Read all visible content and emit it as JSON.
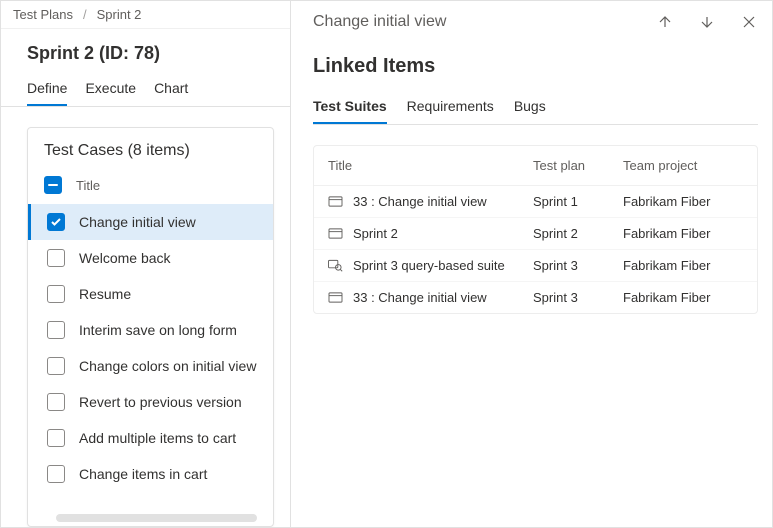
{
  "breadcrumb": {
    "root": "Test Plans",
    "current": "Sprint 2"
  },
  "page": {
    "title": "Sprint 2 (ID: 78)"
  },
  "tabs": {
    "define": "Define",
    "execute": "Execute",
    "chart": "Chart"
  },
  "testcases": {
    "header": "Test Cases (8 items)",
    "title_col": "Title",
    "items": [
      {
        "label": "Change initial view",
        "selected": true
      },
      {
        "label": "Welcome back",
        "selected": false
      },
      {
        "label": "Resume",
        "selected": false
      },
      {
        "label": "Interim save on long form",
        "selected": false
      },
      {
        "label": "Change colors on initial view",
        "selected": false
      },
      {
        "label": "Revert to previous version",
        "selected": false
      },
      {
        "label": "Add multiple items to cart",
        "selected": false
      },
      {
        "label": "Change items in cart",
        "selected": false
      }
    ]
  },
  "sidepanel": {
    "title": "Change initial view",
    "section_header": "Linked Items",
    "tabs": {
      "suites": "Test Suites",
      "reqs": "Requirements",
      "bugs": "Bugs"
    },
    "columns": {
      "title": "Title",
      "plan": "Test plan",
      "project": "Team project"
    },
    "rows": [
      {
        "icon": "static",
        "title": "33 : Change initial view",
        "plan": "Sprint 1",
        "project": "Fabrikam Fiber"
      },
      {
        "icon": "static",
        "title": "Sprint 2",
        "plan": "Sprint 2",
        "project": "Fabrikam Fiber"
      },
      {
        "icon": "query",
        "title": "Sprint 3 query-based suite",
        "plan": "Sprint 3",
        "project": "Fabrikam Fiber"
      },
      {
        "icon": "static",
        "title": "33 : Change initial view",
        "plan": "Sprint 3",
        "project": "Fabrikam Fiber"
      }
    ]
  }
}
